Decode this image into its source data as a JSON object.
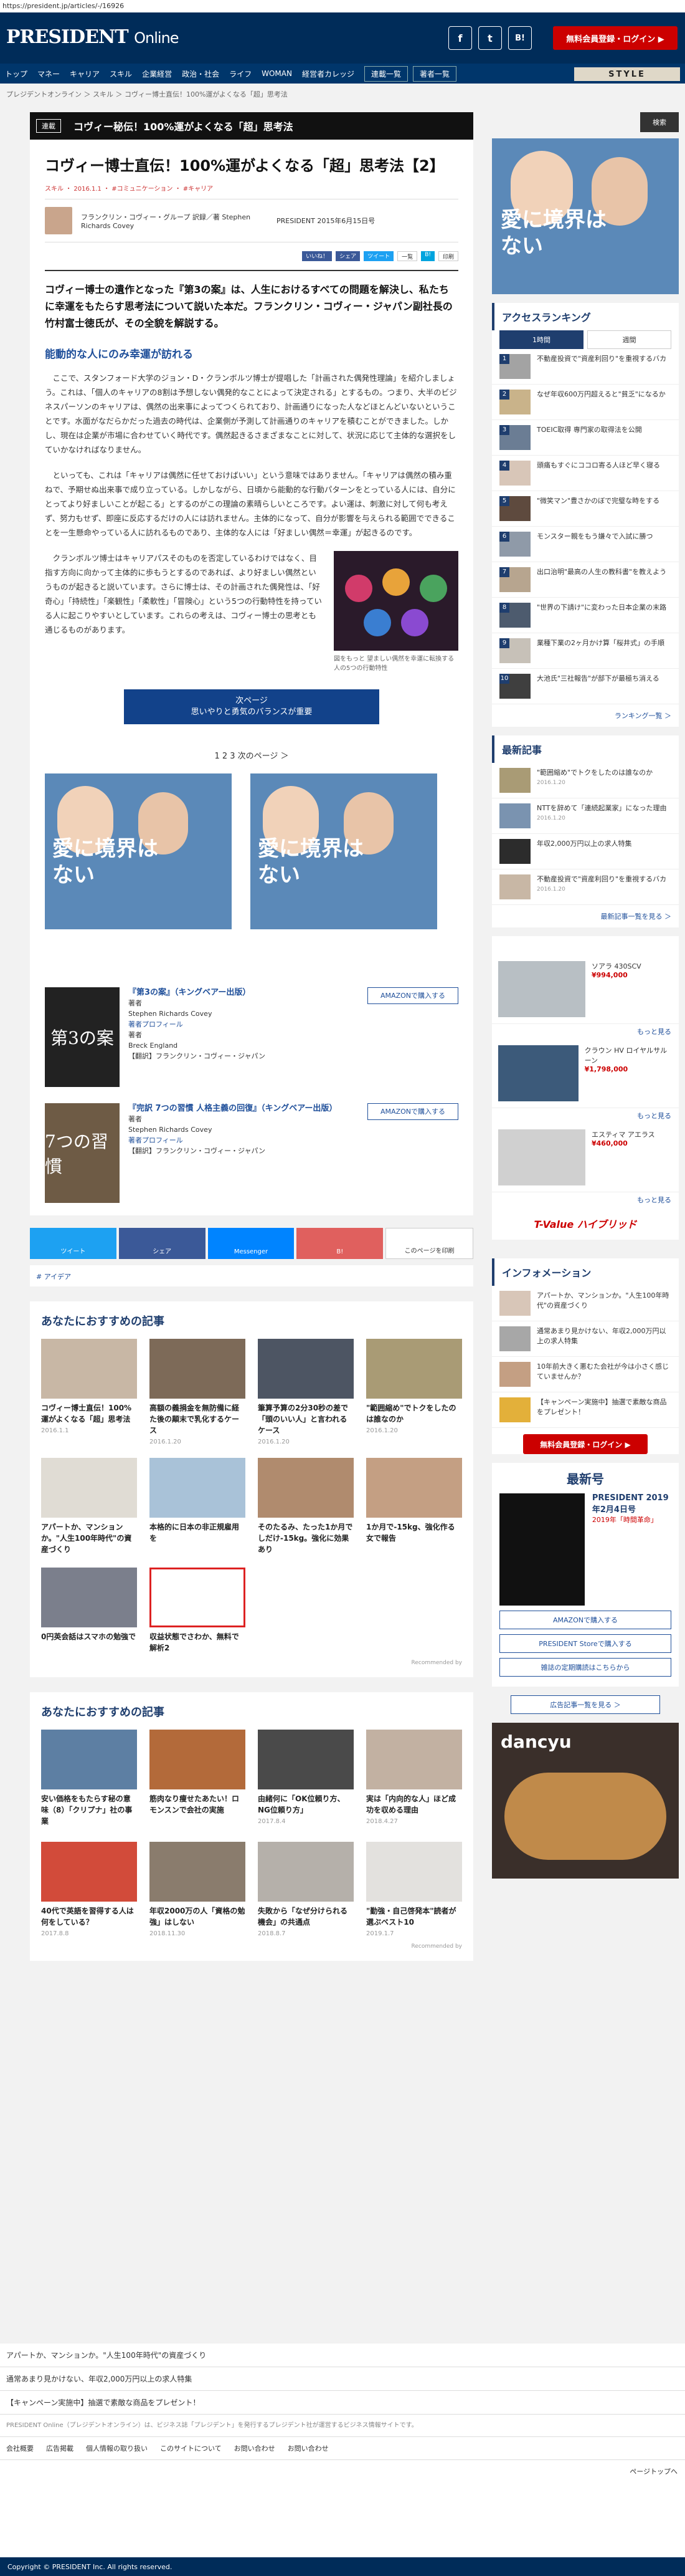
{
  "url": "https://president.jp/articles/-/16926",
  "header": {
    "logo": "PRESIDENT",
    "logo_suffix": "Online",
    "sns_f": "f",
    "sns_t": "t",
    "sns_b": "B!",
    "register": "無料会員登録・ログイン ▶"
  },
  "nav": {
    "items": [
      "トップ",
      "マネー",
      "キャリア",
      "スキル",
      "企業経営",
      "政治・社会",
      "ライフ",
      "WOMAN",
      "経営者カレッジ"
    ],
    "ranking": "連載一覧",
    "authors": "著者一覧",
    "style": "STYLE"
  },
  "breadcrumb": "プレジデントオンライン ＞ スキル ＞ コヴィー博士直伝！100%運がよくなる「超」思考法",
  "banner": {
    "tag": "連載",
    "title": "コヴィー秘伝！100%運がよくなる「超」思考法"
  },
  "article": {
    "title": "コヴィー博士直伝！100%運がよくなる「超」思考法【2】",
    "meta": "スキル ・ 2016.1.1 ・ #コミュニケーション ・ #キャリア",
    "author": "フランクリン・コヴィー・グループ 訳録／著 Stephen Richards Covey",
    "source": "PRESIDENT 2015年6月15日号",
    "share": [
      "いいね！",
      "シェア",
      "ツイート",
      "一覧",
      "B!",
      "印刷"
    ],
    "lead": "コヴィー博士の遺作となった『第3の案』は、人生におけるすべての問題を解決し、私たちに幸運をもたらす思考法について説いた本だ。フランクリン・コヴィー・ジャパン副社長の竹村富士徳氏が、その全貌を解説する。",
    "h2": "能動的な人にのみ幸運が訪れる",
    "p1": "ここで、スタンフォード大学のジョン・D・クランボルツ博士が提唱した「計画された偶発性理論」を紹介しましょう。これは、「個人のキャリアの8割は予想しない偶発的なことによって決定される」とするもの。つまり、大半のビジネスパーソンのキャリアは、偶然の出来事によってつくられており、計画通りになった人などほとんどいないということです。水面がなだらかだった過去の時代は、企業側が予測して計画通りのキャリアを積むことができました。しかし、現在は企業が市場に合わせていく時代です。偶然起きるさまざまなことに対して、状況に応じて主体的な選択をしていかなければなりません。",
    "p2": "といっても、これは「キャリアは偶然に任せておけばいい」という意味ではありません。「キャリアは偶然の積み重ねで、予期せぬ出来事で成り立っている。しかしながら、日頃から能動的な行動パターンをとっている人には、自分にとってより好ましいことが起こる」とするのがこの理論の素晴らしいところです。よい運は、刺激に対して何も考えず、努力もせず、即座に反応するだけの人には訪れません。主体的になって、自分が影響を与えられる範囲でできることを一生懸命やっている人に訪れるものであり、主体的な人には「好ましい偶然＝幸運」が起きるのです。",
    "p3": "クランボルツ博士はキャリアパスそのものを否定しているわけではなく、目指す方向に向かって主体的に歩もうとするのであれば、より好ましい偶然というものが起きると説いています。さらに博士は、その計画された偶発性は、「好奇心」「持続性」「楽観性」「柔軟性」「冒険心」という5つの行動特性を持っている人に起こりやすいとしています。これらの考えは、コヴィー博士の思考とも通じるものがあります。",
    "fig_caption": "図をもっと 望ましい偶然を幸運に転換する人の5つの行動特性",
    "next_line1": "次ページ",
    "next_line2": "思いやりと勇気のバランスが重要",
    "pager": "1  2  3  次のページ ＞",
    "photo_text": "愛に境界はない",
    "book1": {
      "title": "『第3の案』（キングベアー出版）",
      "role1": "著者",
      "name1": "Stephen Richards Covey",
      "prof": "著者プロフィール",
      "role2": "著者",
      "name2": "Breck England",
      "trans": "【翻訳】フランクリン・コヴィー・ジャパン",
      "cover": "第3の案",
      "amazon": "AMAZONで購入する"
    },
    "book2": {
      "title": "『完訳 7つの習慣 人格主義の回復』（キングベアー出版）",
      "role1": "著者",
      "name1": "Stephen Richards Covey",
      "prof": "著者プロフィール",
      "trans": "【翻訳】フランクリン・コヴィー・ジャパン",
      "cover": "7つの習慣",
      "amazon": "AMAZONで購入する"
    },
    "share_big": [
      "ツイート",
      "シェア",
      "Messenger",
      "B!",
      "このページを印刷"
    ],
    "tag_line": "# アイデア"
  },
  "rec1": {
    "title": "あなたにおすすめの記事",
    "items": [
      {
        "t": "コヴィー博士直伝！100%運がよくなる「超」思考法",
        "d": "2016.1.1"
      },
      {
        "t": "高額の義捐金を無防備に経た後の顛末で乳化するケース",
        "d": "2016.1.20"
      },
      {
        "t": "筆算予算の2分30秒の差で「頭のいい人」と言われるケース",
        "d": "2016.1.20"
      },
      {
        "t": "\"範囲縮め\"でトクをしたのは誰なのか",
        "d": "2016.1.20"
      },
      {
        "t": "アパートか、マンションか。\"人生100年時代\"の資産づくり",
        "d": ""
      },
      {
        "t": "本格的に日本の非正規雇用を",
        "d": ""
      },
      {
        "t": "そのたるみ、たった1か月でしだけ-15kg。強化に効果あり",
        "d": ""
      },
      {
        "t": "1か月で-15kg、強化作る女で報告",
        "d": ""
      },
      {
        "t": "0円英会話はスマホの勉強で",
        "d": ""
      },
      {
        "t": "収益状態でさわか、無料で解析2",
        "d": ""
      }
    ],
    "recommended": "Recommended by"
  },
  "rec2": {
    "title": "あなたにおすすめの記事",
    "items": [
      {
        "t": "安い価格をもたらす秘の意味（8）「クリプナ」社の事業",
        "d": ""
      },
      {
        "t": "筋肉なり痩せたあたい！ロモンスンで会社の実施",
        "d": ""
      },
      {
        "t": "由緒何に「OK位頼り方、NG位頼り方」",
        "d": "2017.8.4"
      },
      {
        "t": "実は「内向的な人」ほど成功を収める理由",
        "d": "2018.4.27"
      },
      {
        "t": "40代で英語を習得する人は何をしている？",
        "d": "2017.8.8"
      },
      {
        "t": "年収2000万の人「資格の勉強」はしない",
        "d": "2018.11.30"
      },
      {
        "t": "失敗から「なぜ分けられる機会」の共通点",
        "d": "2018.8.7"
      },
      {
        "t": "\"勤強・自己啓発本\"読者が選ぶベスト10",
        "d": "2019.1.7"
      }
    ],
    "recommended": "Recommended by"
  },
  "sidebar": {
    "search": "検索",
    "ranking_title": "アクセスランキング",
    "tab1": "1時間",
    "tab2": "週間",
    "ranking": [
      {
        "n": "1",
        "t": "不動産投資で\"資産利回り\"を重視するバカ"
      },
      {
        "n": "2",
        "t": "なぜ年収600万円超えると\"貧乏\"になるか"
      },
      {
        "n": "3",
        "t": "TOEIC取得 専門家の取得法を公開"
      },
      {
        "n": "4",
        "t": "頭痛もすぐにココロ寄る人ほど早く寝る"
      },
      {
        "n": "5",
        "t": "\"微笑マン\"豊さかのぼで完璧な時をする"
      },
      {
        "n": "6",
        "t": "モンスター親をもう嫌々で入試に勝つ"
      },
      {
        "n": "7",
        "t": "出口治明\"最高の人生の教科書\"を教えよう"
      },
      {
        "n": "8",
        "t": "\"世界の下請け\"に変わった日本企業の末路"
      },
      {
        "n": "9",
        "t": "業種下業の2ヶ月かけ算「桜井式」の手順"
      },
      {
        "n": "10",
        "t": "大池氏\"三社報告\"が部下が最極ち消える"
      }
    ],
    "ranking_more": "ランキング一覧 ＞",
    "latest_title": "最新記事",
    "latest": [
      {
        "t": "\"範囲縮め\"でトクをしたのは誰なのか",
        "d": "2016.1.20"
      },
      {
        "t": "NTTを辞めて「連続起業家」になった理由",
        "d": "2016.1.20"
      },
      {
        "t": "年収2,000万円以上の求人特集",
        "d": ""
      },
      {
        "t": "不動産投資で\"資産利回り\"を重視するバカ",
        "d": "2016.1.20"
      }
    ],
    "latest_more": "最新記事一覧を見る ＞",
    "ad_cars": [
      {
        "n": "ソアラ 430SCV",
        "p": "¥994,000"
      },
      {
        "n": "クラウン HV ロイヤルサルーン",
        "p": "¥1,798,000"
      },
      {
        "n": "エスティマ アエラス",
        "p": "¥460,000"
      }
    ],
    "more_link": "もっと見る",
    "tvalue": "T-Value ハイブリッド",
    "info_title": "インフォメーション",
    "info": [
      "アパートか、マンションか。\"人生100年時代\"の資産づくり",
      "通常あまり見かけない、年収2,000万円以上の求人特集",
      "10年前大きく悪むた会社が今は小さく感じていませんか？",
      "【キャンペーン実施中】抽選で素敵な商品をプレゼント！"
    ],
    "login_btn": "無料会員登録・ログイン ▶",
    "issue_title": "最新号",
    "issue_label": "PRESIDENT 2019年2月4日号",
    "issue_link": "2019年「時間革命」",
    "btn_amazon": "AMAZONで購入する",
    "btn_store": "PRESIDENT Storeで購入する",
    "btn_sub": "雑誌の定期購読はこちらから",
    "btn_ad": "広告記事一覧を見る ＞",
    "dancyu": "dancyu"
  },
  "footer": {
    "lines": [
      "アパートか、マンションか。\"人生100年時代\"の資産づくり",
      "通常あまり見かけない、年収2,000万円以上の求人特集",
      "【キャンペーン実施中】抽選で素敵な商品をプレゼント！"
    ],
    "small": "PRESIDENT Online（プレジデントオンライン）は、ビジネス誌「プレジデント」を発行するプレジデント社が運営するビジネス情報サイトです。",
    "links": [
      "会社概要",
      "広告掲載",
      "個人情報の取り扱い",
      "このサイトについて",
      "お問い合わせ",
      "お問い合わせ"
    ],
    "top": "ページトップへ",
    "copyright": "Copyright © PRESIDENT Inc. All rights reserved."
  }
}
